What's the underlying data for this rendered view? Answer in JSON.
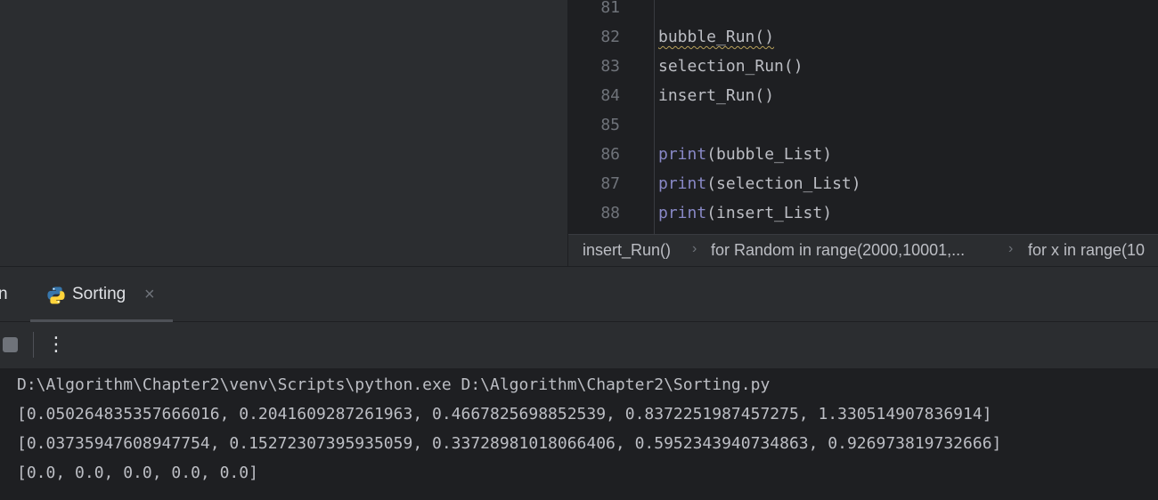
{
  "editor": {
    "lines": [
      {
        "number": "81",
        "parts": []
      },
      {
        "number": "82",
        "parts": [
          {
            "text": "bubble_Run()",
            "style": "squiggle"
          }
        ]
      },
      {
        "number": "83",
        "parts": [
          {
            "text": "selection_Run()",
            "style": "plain"
          }
        ]
      },
      {
        "number": "84",
        "parts": [
          {
            "text": "insert_Run()",
            "style": "plain"
          }
        ]
      },
      {
        "number": "85",
        "parts": []
      },
      {
        "number": "86",
        "parts": [
          {
            "text": "print",
            "style": "kw"
          },
          {
            "text": "(bubble_List)",
            "style": "plain"
          }
        ]
      },
      {
        "number": "87",
        "parts": [
          {
            "text": "print",
            "style": "kw"
          },
          {
            "text": "(selection_List)",
            "style": "plain"
          }
        ]
      },
      {
        "number": "88",
        "parts": [
          {
            "text": "print",
            "style": "kw"
          },
          {
            "text": "(insert_List)",
            "style": "plain"
          }
        ]
      }
    ]
  },
  "breadcrumbs": {
    "items": [
      "insert_Run()",
      "for Random in range(2000,10001,...",
      "for x in range(10"
    ],
    "separator": "›"
  },
  "tool_window": {
    "partial_tab_label": "n",
    "tab_label": "Sorting",
    "tab_close": "×",
    "more_label": "⋮"
  },
  "console": {
    "lines": [
      "D:\\Algorithm\\Chapter2\\venv\\Scripts\\python.exe D:\\Algorithm\\Chapter2\\Sorting.py",
      "[0.050264835357666016, 0.2041609287261963, 0.4667825698852539, 0.8372251987457275, 1.330514907836914]",
      "[0.03735947608947754, 0.15272307395935059, 0.33728981018066406, 0.5952343940734863, 0.926973819732666]",
      "[0.0, 0.0, 0.0, 0.0, 0.0]"
    ]
  },
  "colors": {
    "background": "#1e1f22",
    "panel": "#2b2d30",
    "code_text": "#bcbec4",
    "builtin_keyword": "#8888c6",
    "line_numbers": "#6f737a",
    "python_icon_blue": "#3776ab",
    "python_icon_yellow": "#ffd43b"
  },
  "icons": {
    "tab_icon": "python-file-icon",
    "stop": "stop-icon",
    "more": "more-vertical-icon",
    "close": "close-icon",
    "separator": "chevron-right-icon"
  }
}
